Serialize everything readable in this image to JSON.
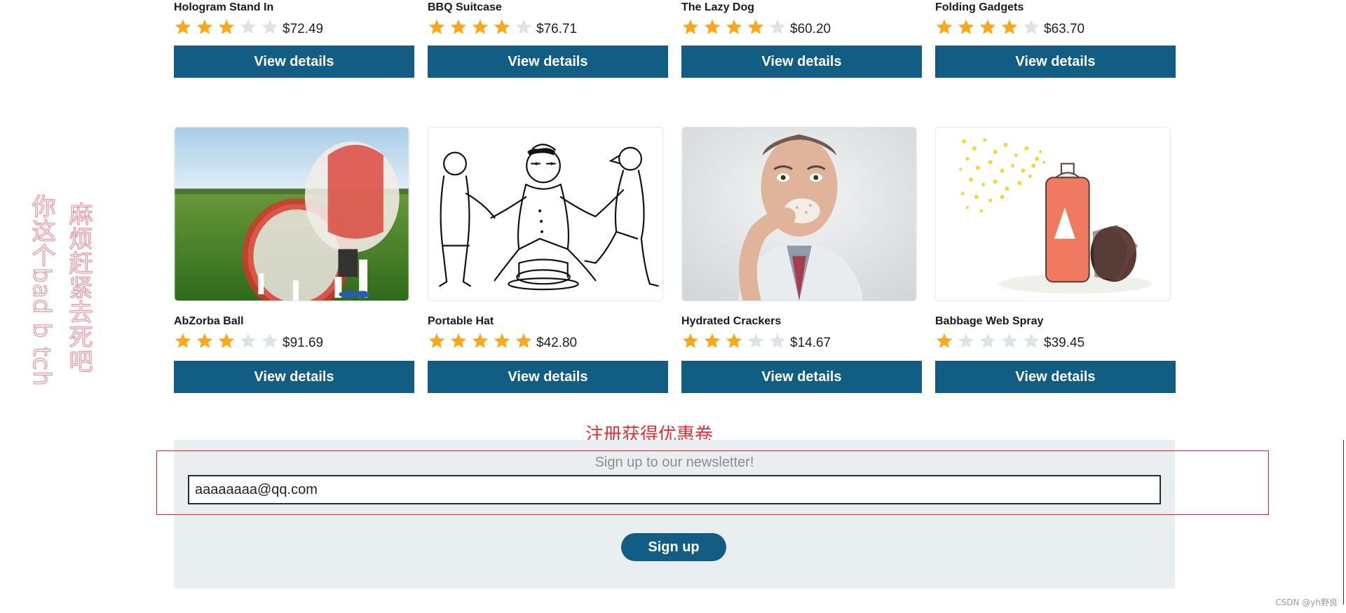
{
  "products_top": [
    {
      "name": "Hologram Stand In",
      "rating": 3,
      "price": "$72.49",
      "button": "View details"
    },
    {
      "name": "BBQ Suitcase",
      "rating": 4,
      "price": "$76.71",
      "button": "View details"
    },
    {
      "name": "The Lazy Dog",
      "rating": 4,
      "price": "$60.20",
      "button": "View details"
    },
    {
      "name": "Folding Gadgets",
      "rating": 4,
      "price": "$63.70",
      "button": "View details"
    }
  ],
  "products_bottom": [
    {
      "name": "AbZorba Ball",
      "rating": 3,
      "price": "$91.69",
      "button": "View details",
      "image": "zorb-ball-photo"
    },
    {
      "name": "Portable Hat",
      "rating": 5,
      "price": "$42.80",
      "button": "View details",
      "image": "hat-cartoon-drawing"
    },
    {
      "name": "Hydrated Crackers",
      "rating": 3,
      "price": "$14.67",
      "button": "View details",
      "image": "man-eating-cracker-photo"
    },
    {
      "name": "Babbage Web Spray",
      "rating": 1,
      "price": "$39.45",
      "button": "View details",
      "image": "spray-can-illustration"
    }
  ],
  "max_rating": 5,
  "colors": {
    "star_on": "#f9a81c",
    "star_off": "#dde3e8",
    "button": "#115d83",
    "annotation_red": "#e0303b",
    "side_text": "#e8949c"
  },
  "annotations": {
    "side_text_1": "你这个bad b tch",
    "side_text_2": "麻烦赶紧去死吧",
    "newsletter_heading": "注册获得优惠卷"
  },
  "newsletter": {
    "caption": "Sign up to our newsletter!",
    "email_value": "aaaaaaaa@qq.com",
    "button": "Sign up"
  },
  "watermark": "CSDN @yh野良"
}
